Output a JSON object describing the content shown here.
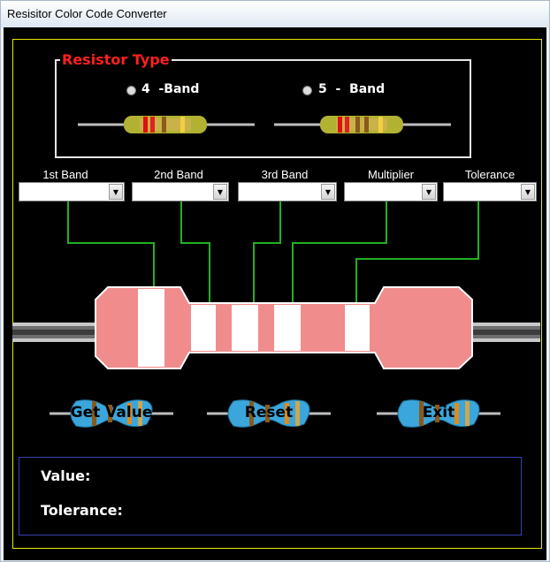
{
  "window": {
    "title": "Resisitor Color Code Converter"
  },
  "resistor_type": {
    "legend": "Resistor Type",
    "options": [
      {
        "label": "4  -Band",
        "selected": false
      },
      {
        "label": "5  -  Band",
        "selected": false
      }
    ]
  },
  "bands": [
    {
      "label": "1st Band",
      "value": ""
    },
    {
      "label": "2nd Band",
      "value": ""
    },
    {
      "label": "3rd  Band",
      "value": ""
    },
    {
      "label": "Multiplier",
      "value": ""
    },
    {
      "label": "Tolerance",
      "value": ""
    }
  ],
  "buttons": {
    "get_value": "Get Value",
    "reset": "Reset",
    "exit": "Exit"
  },
  "result": {
    "value_label": "Value:",
    "value": "",
    "tolerance_label": "Tolerance:",
    "tolerance": ""
  },
  "colors": {
    "background": "#000000",
    "frame": "#e8e800",
    "legend": "#ff2020",
    "connector": "#22b022",
    "resistor_body": "#f08c8c",
    "band_stripe": "#ffffff",
    "button_body": "#3aa6dc",
    "result_border": "#3a40b0"
  },
  "icons": {
    "combo_arrow": "chevron-down-icon",
    "radio": "radio-icon"
  }
}
